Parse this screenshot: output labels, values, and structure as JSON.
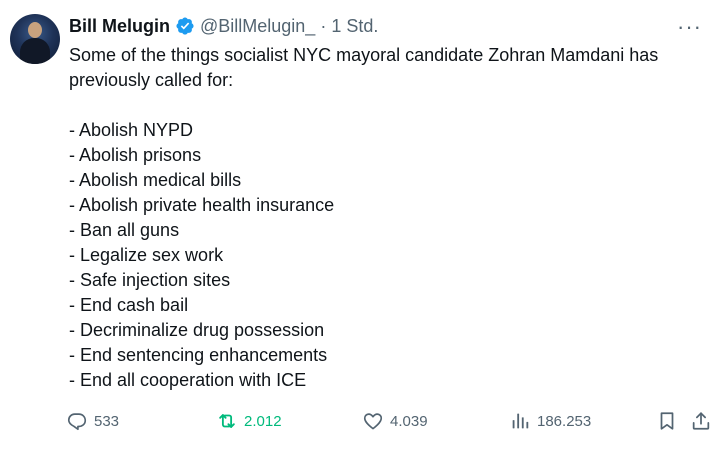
{
  "author": {
    "name": "Bill Melugin",
    "handle": "@BillMelugin_",
    "separator": "·",
    "time": "1 Std."
  },
  "more_label": "···",
  "tweet": {
    "intro_lines": [
      "Some of the things socialist NYC mayoral candidate Zohran Mamdani has",
      "previously called for:"
    ],
    "list": [
      "- Abolish NYPD",
      "- Abolish prisons",
      "- Abolish medical bills",
      "- Abolish private health insurance",
      "- Ban all guns",
      "- Legalize sex work",
      "- Safe injection sites",
      "- End cash bail",
      "- Decriminalize drug possession",
      "- End sentencing enhancements",
      "- End all cooperation with ICE"
    ]
  },
  "stats": {
    "replies": "533",
    "reposts": "2.012",
    "likes": "4.039",
    "views": "186.253"
  },
  "colors": {
    "text": "#0f1419",
    "muted": "#536471",
    "verified": "#1d9bf0",
    "repost_active": "#00ba7c"
  }
}
